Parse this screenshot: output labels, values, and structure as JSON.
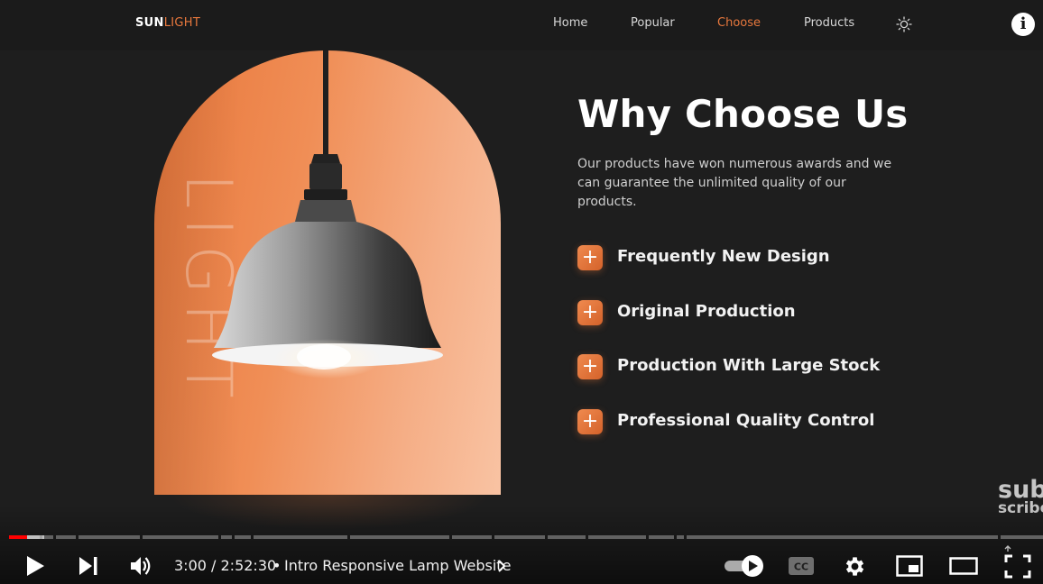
{
  "site": {
    "logo_primary": "SUN",
    "logo_accent": "LIGHT",
    "nav": [
      {
        "label": "Home",
        "active": false
      },
      {
        "label": "Popular",
        "active": false
      },
      {
        "label": "Choose",
        "active": true
      },
      {
        "label": "Products",
        "active": false
      }
    ],
    "theme_toggle_icon": "sun-icon",
    "accent_color": "#e8783d"
  },
  "hero": {
    "vertical_word": "LIGHT",
    "image_icon": "pendant-lamp"
  },
  "section": {
    "title": "Why Choose Us",
    "description": "Our products have won numerous awards and we can guarantee the unlimited quality of our products.",
    "features": [
      {
        "icon": "plus-icon",
        "label": "Frequently New Design"
      },
      {
        "icon": "plus-icon",
        "label": "Original Production"
      },
      {
        "icon": "plus-icon",
        "label": "Production With Large Stock"
      },
      {
        "icon": "plus-icon",
        "label": "Professional Quality Control"
      }
    ]
  },
  "watermark": {
    "line1": "sub",
    "line2": "scribe"
  },
  "player": {
    "current_time": "3:00",
    "duration": "2:52:30",
    "time_display": "3:00 / 2:52:30",
    "separator": "•",
    "chapter_title": "Intro Responsive Lamp Website",
    "progress_fraction": 0.017,
    "autoplay_on": true,
    "played_color": "#ff0000",
    "icons": [
      "play-icon",
      "next-icon",
      "volume-icon",
      "autoplay-toggle-icon",
      "captions-icon",
      "settings-icon",
      "miniplayer-icon",
      "theater-icon",
      "fullscreen-icon",
      "info-icon"
    ]
  }
}
